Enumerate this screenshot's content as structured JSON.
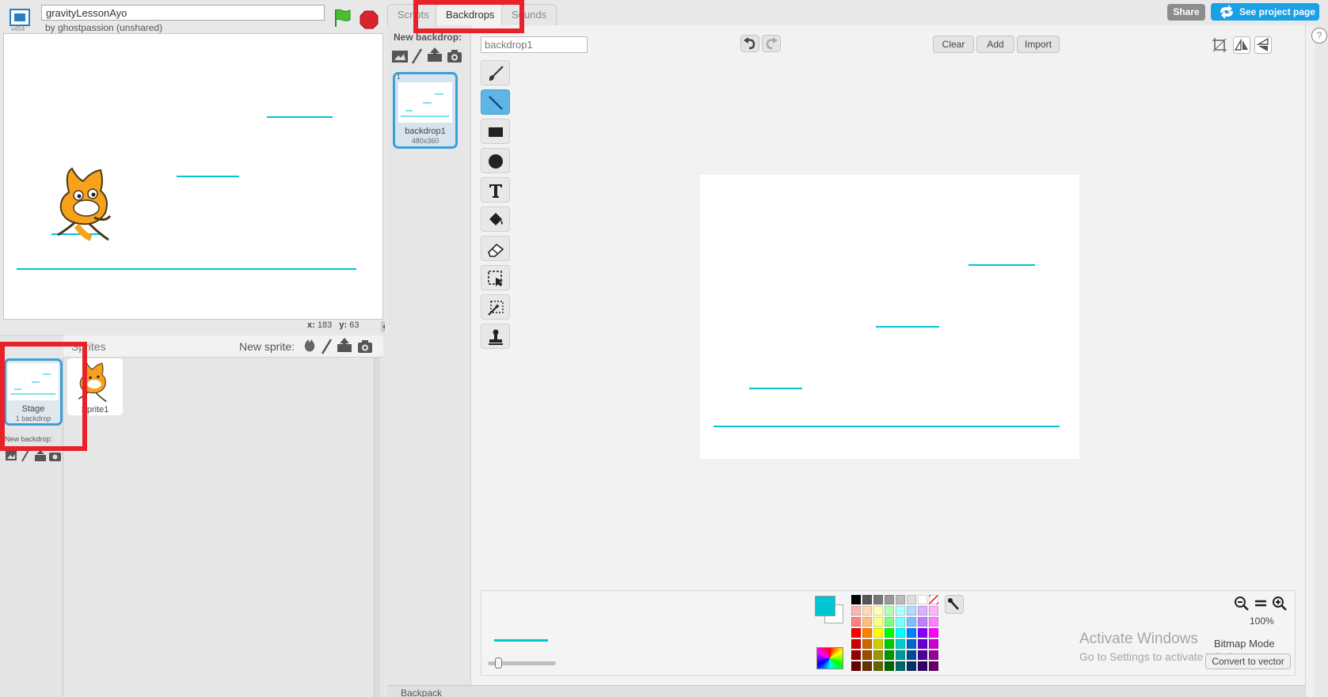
{
  "project": {
    "title": "gravityLessonAyo",
    "byline": "by ghostpassion (unshared)",
    "version": "v454"
  },
  "stage": {
    "mouse_x_label": "x:",
    "mouse_x": "183",
    "mouse_y_label": "y:",
    "mouse_y": "63"
  },
  "sprites_pane": {
    "label": "Sprites",
    "new_sprite_label": "New sprite:",
    "stage_thumb": {
      "name": "Stage",
      "sub": "1 backdrop",
      "new_backdrop_label": "New backdrop:"
    },
    "sprites": [
      {
        "name": "Sprite1"
      }
    ]
  },
  "tabs": [
    {
      "label": "Scripts"
    },
    {
      "label": "Backdrops"
    },
    {
      "label": "Sounds"
    }
  ],
  "header_buttons": {
    "share": "Share",
    "see_project": "See project page"
  },
  "backdrop_list": {
    "new_backdrop_label": "New backdrop:",
    "items": [
      {
        "number": "1",
        "name": "backdrop1",
        "size": "480x360"
      }
    ]
  },
  "paint_editor": {
    "backdrop_name": "backdrop1",
    "buttons": {
      "clear": "Clear",
      "add": "Add",
      "import": "Import"
    },
    "active_tool": "line",
    "zoom_level": "100%",
    "mode_label": "Bitmap Mode",
    "convert_label": "Convert to vector",
    "primary_color": "#00c5d3",
    "secondary_color": "#ffffff"
  },
  "watermark": {
    "title": "Activate Windows",
    "sub": "Go to Settings to activate Windows."
  },
  "backpack_label": "Backpack",
  "help_label": "?",
  "colors": {
    "accent": "#1aa0e5",
    "line": "#00c5d3",
    "annotation": "#e8222a"
  }
}
